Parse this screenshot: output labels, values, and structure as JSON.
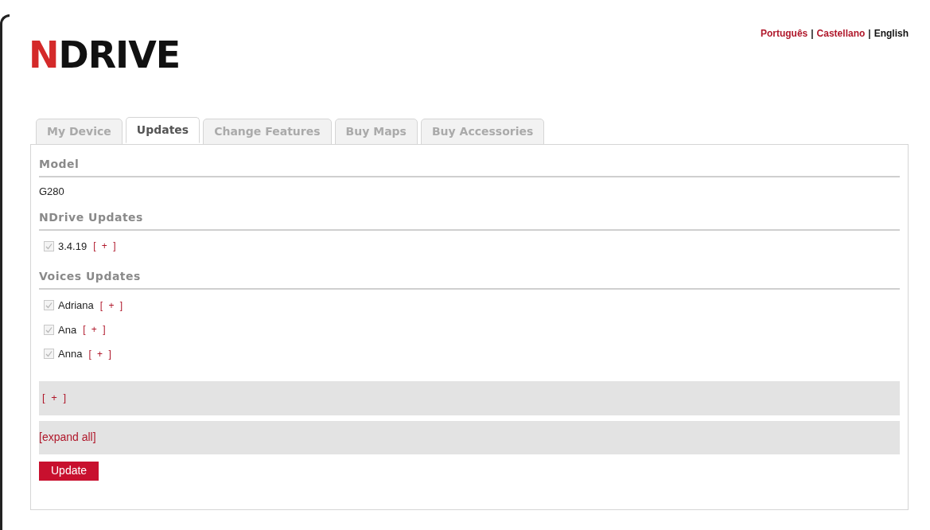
{
  "logo": {
    "initial": "N",
    "rest": "DRIVE"
  },
  "languages": [
    {
      "label": "Português",
      "selected": false
    },
    {
      "label": "Castellano",
      "selected": false
    },
    {
      "label": "English",
      "selected": true
    }
  ],
  "separator": "|",
  "tabs": [
    {
      "label": "My Device",
      "selected": false
    },
    {
      "label": "Updates",
      "selected": true
    },
    {
      "label": "Change Features",
      "selected": false
    },
    {
      "label": "Buy Maps",
      "selected": false
    },
    {
      "label": "Buy Accessories",
      "selected": false
    }
  ],
  "sections": [
    {
      "title": "Model",
      "kind": "text",
      "value": "G280"
    },
    {
      "title": "NDrive Updates",
      "kind": "checklist",
      "items": [
        {
          "label": "3.4.19",
          "checked": true,
          "disabled": true,
          "toggle": "[ + ]"
        }
      ]
    },
    {
      "title": "Voices Updates",
      "kind": "checklist",
      "items": [
        {
          "label": "Adriana",
          "checked": true,
          "disabled": true,
          "toggle": "[ + ]"
        },
        {
          "label": "Ana",
          "checked": true,
          "disabled": true,
          "toggle": "[ + ]"
        },
        {
          "label": "Anna",
          "checked": true,
          "disabled": true,
          "toggle": "[ + ]"
        }
      ]
    }
  ],
  "more_toggle": "[ + ]",
  "expand_all": "[expand all]",
  "update_button": "Update"
}
